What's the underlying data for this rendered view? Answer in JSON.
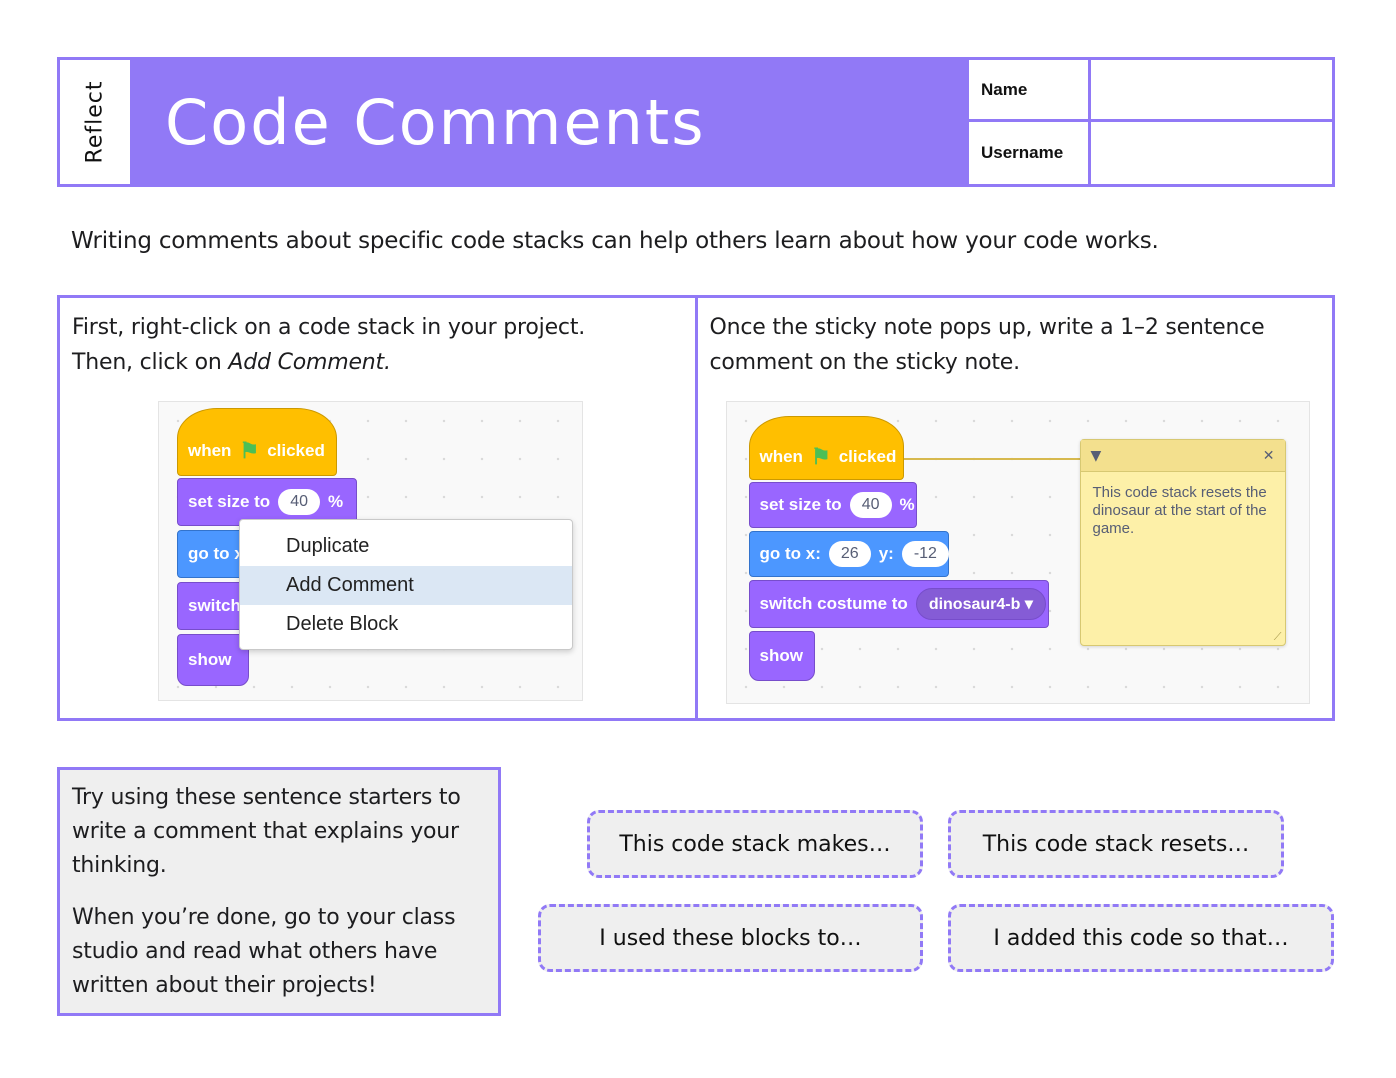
{
  "header": {
    "section_label": "Reflect",
    "title": "Code Comments",
    "name_label": "Name",
    "username_label": "Username"
  },
  "intro": "Writing comments about specific code stacks can help others learn about how your code works.",
  "step1": {
    "line1": "First, right-click on a code stack in your project.",
    "line2_prefix": "Then, click on ",
    "line2_em": "Add Comment."
  },
  "step2": {
    "line1": "Once the sticky note pops up, write a 1–2 sentence",
    "line2": "comment on the sticky note."
  },
  "scratch1": {
    "hat_when": "when",
    "hat_clicked": "clicked",
    "set_size": "set size to",
    "set_size_value": "40",
    "set_size_unit": "%",
    "goto_partial": "go to x",
    "switch_partial": "switch",
    "show": "show",
    "menu": [
      "Duplicate",
      "Add Comment",
      "Delete Block"
    ],
    "menu_highlighted": "Add Comment"
  },
  "scratch2": {
    "hat_when": "when",
    "hat_clicked": "clicked",
    "set_size": "set size to",
    "set_size_value": "40",
    "set_size_unit": "%",
    "goto_x": "go to x:",
    "goto_x_value": "26",
    "goto_y": "y:",
    "goto_y_value": "-12",
    "switch_costume": "switch costume to",
    "costume": "dinosaur4-b",
    "show": "show",
    "comment": "This code stack resets the dinosaur at the start of the game."
  },
  "tip": {
    "p1": "Try using these sentence starters to write a comment that explains your thinking.",
    "p2": "When you’re done, go to your class studio and read what others have written about their projects!"
  },
  "starters": [
    "This code stack makes…",
    "This code stack resets…",
    "I used these blocks to…",
    "I added this code so that…"
  ],
  "colors": {
    "accent": "#9179f6",
    "hat_block": "#ffbf00",
    "looks_block": "#9966ff",
    "motion_block": "#4c97ff",
    "sticky_note": "#fdf0a8",
    "tip_background": "#efefef"
  }
}
